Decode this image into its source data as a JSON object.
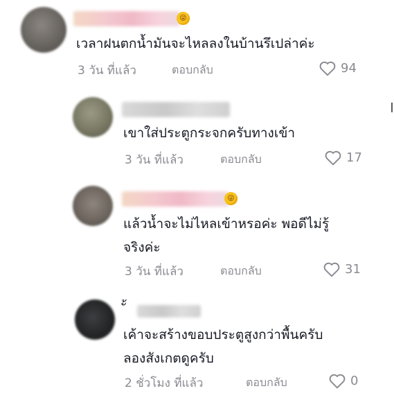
{
  "comments": [
    {
      "text_lines": [
        "เวลาฝนตกน้ำมันจะไหลลงในบ้านรึเปล่าค่ะ"
      ],
      "time": "3 วัน ที่แล้ว",
      "reply_label": "ตอบกลับ",
      "likes": "94",
      "has_emoji": true
    },
    {
      "text_lines": [
        "เขาใส่ประตูกระจกครับทางเข้า"
      ],
      "time": "3 วัน ที่แล้ว",
      "reply_label": "ตอบกลับ",
      "likes": "17",
      "has_emoji": false
    },
    {
      "text_lines": [
        "แล้วน้ำจะไม่ไหลเข้าหรอค่ะ พอดีไม่รู้",
        "จริงค่ะ"
      ],
      "time": "3 วัน ที่แล้ว",
      "reply_label": "ตอบกลับ",
      "likes": "31",
      "has_emoji": true
    },
    {
      "username_visible": "ั้",
      "text_lines": [
        "เค้าจะสร้างขอบประตูสูงกว่าพื้นครับ",
        "ลองสังเกตดูครับ"
      ],
      "time": "2 ชั่วโมง ที่แล้ว",
      "reply_label": "ตอบกลับ",
      "likes": "0",
      "has_emoji": false
    }
  ],
  "icons": {
    "like": "heart-outline-icon",
    "emoji": "winking-tongue-emoji-icon"
  },
  "colors": {
    "text": "#161823",
    "meta": "#8a8b91"
  }
}
